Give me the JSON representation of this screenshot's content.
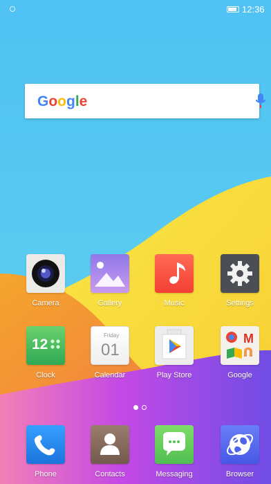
{
  "status_bar": {
    "time": "12:36"
  },
  "search": {
    "logo_parts": [
      "G",
      "o",
      "o",
      "g",
      "l",
      "e"
    ]
  },
  "apps_row_1": [
    {
      "label": "Camera"
    },
    {
      "label": "Gallery"
    },
    {
      "label": "Music"
    },
    {
      "label": "Settings"
    }
  ],
  "apps_row_2": [
    {
      "label": "Clock"
    },
    {
      "label": "Calendar"
    },
    {
      "label": "Play Store"
    },
    {
      "label": "Google"
    }
  ],
  "dock": [
    {
      "label": "Phone"
    },
    {
      "label": "Contacts"
    },
    {
      "label": "Messaging"
    },
    {
      "label": "Browser"
    }
  ],
  "icons": {
    "clock_time": "12",
    "calendar_day": "01",
    "calendar_weekday": "Friday",
    "gmail_mark": "M"
  },
  "page_indicator": {
    "active": 1,
    "total": 2
  }
}
